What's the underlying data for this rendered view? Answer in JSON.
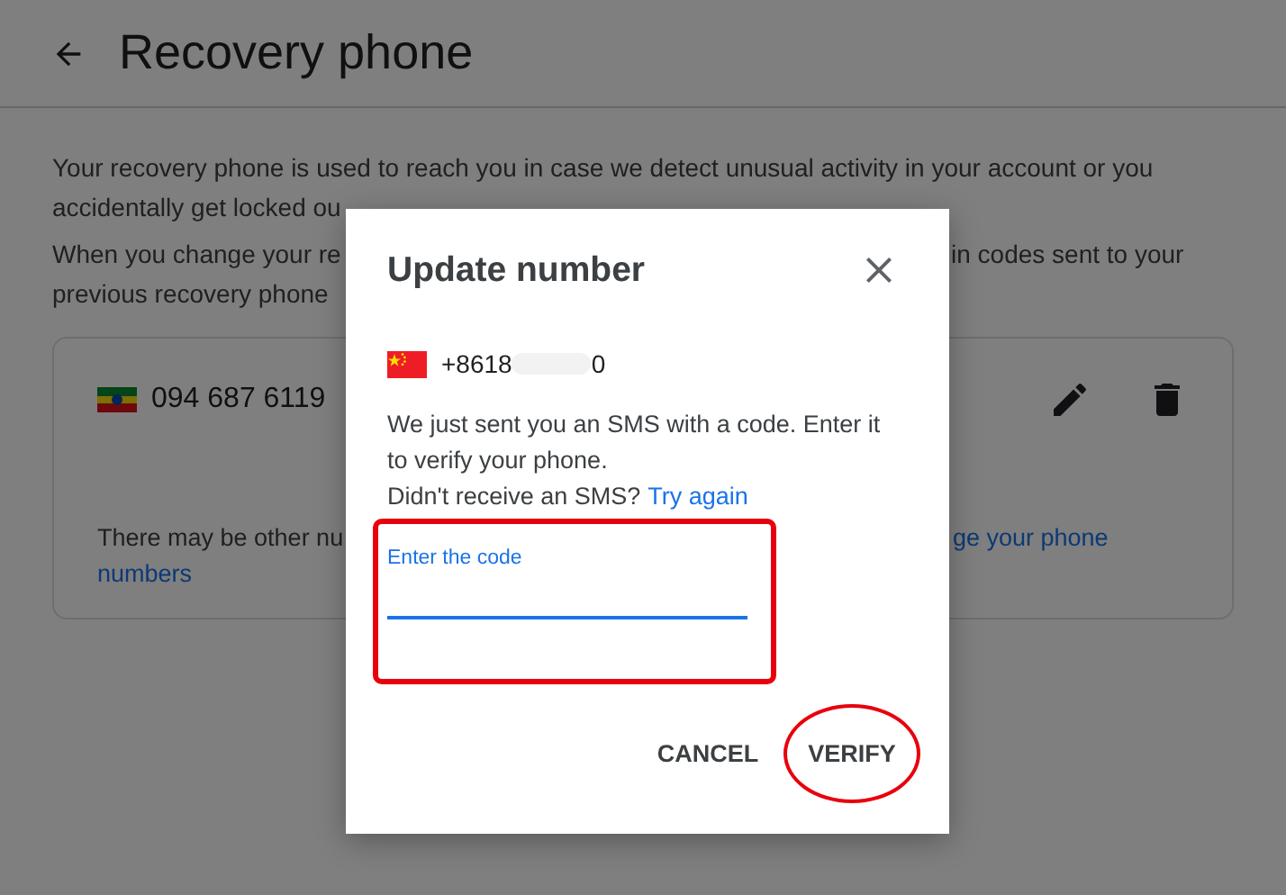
{
  "header": {
    "title": "Recovery phone"
  },
  "intro": [
    {
      "lines": [
        {
          "left": {
            "text": "Your recovery phone is used to reach you in case we detect unusual activity in your account or you",
            "link": false
          }
        },
        {
          "left": {
            "text": "accidentally get locked ou",
            "link": false
          }
        }
      ]
    },
    {
      "lines": [
        {
          "left": {
            "text": "When you change your re",
            "link": false
          },
          "right": {
            "text": "in codes sent to your",
            "link": false
          }
        },
        {
          "left": {
            "text": "previous recovery phone",
            "link": false
          }
        }
      ]
    }
  ],
  "phone_card": {
    "number": "094 687 6119",
    "note_lines": [
      {
        "left": {
          "text": "There may be other nu",
          "link": false
        },
        "right": {
          "text": "ge your phone",
          "link": true
        }
      },
      {
        "left": {
          "text": "numbers",
          "link": true
        }
      }
    ]
  },
  "dialog": {
    "title": "Update number",
    "phone": {
      "prefix": "+8618",
      "suffix": "0"
    },
    "message": "We just sent you an SMS with a code. Enter it to verify your phone.",
    "resend": {
      "text": "Didn't receive an SMS?",
      "link": "Try again"
    },
    "code_field": {
      "label": "Enter the code",
      "focused": true,
      "boxed_in_red": true
    },
    "buttons": [
      {
        "label": "CANCEL",
        "circled_in_red": false
      },
      {
        "label": "VERIFY",
        "circled_in_red": true
      }
    ]
  }
}
